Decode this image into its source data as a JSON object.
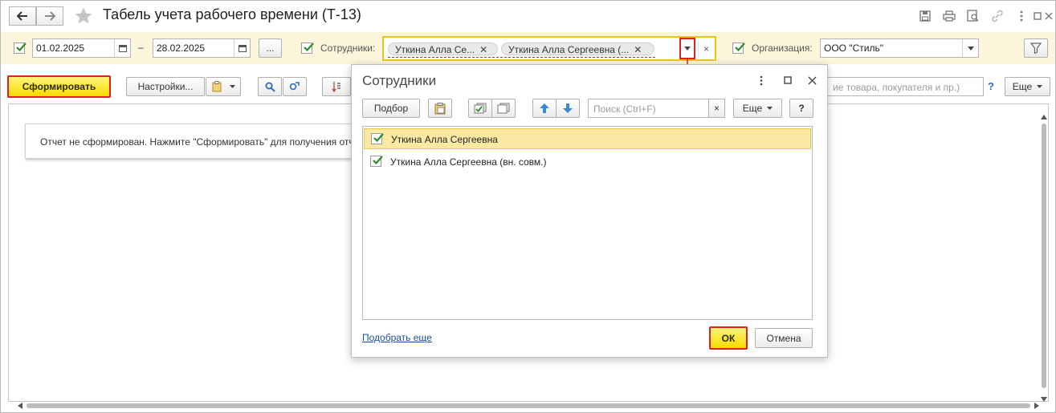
{
  "window": {
    "title": "Табель учета рабочего времени (Т-13)",
    "back_icon": "arrow-left-icon",
    "forward_icon": "arrow-right-icon",
    "favorite_icon": "star-icon",
    "top_icons": [
      "save-icon",
      "print-icon",
      "preview-icon",
      "link-icon",
      "more-vertical-icon",
      "maximize-icon",
      "close-icon"
    ]
  },
  "filters": {
    "period_enabled": true,
    "date_from": "01.02.2025",
    "dash": "–",
    "date_to": "28.02.2025",
    "period_more": "...",
    "employees_enabled": true,
    "employees_label": "Сотрудники:",
    "employee_tags": [
      "Уткина Алла Се...",
      "Уткина Алла Сергеевна (..."
    ],
    "clear_symbol": "×",
    "organization_enabled": true,
    "organization_label": "Организация:",
    "organization_value": "ООО \"Стиль\""
  },
  "toolbar": {
    "generate_label": "Сформировать",
    "settings_label": "Настройки...",
    "search_placeholder": "ие товара, покупателя и пр.)",
    "help_label": "?",
    "more_label": "Еще"
  },
  "report": {
    "notice": "Отчет не сформирован. Нажмите \"Сформировать\" для получения отчета."
  },
  "dialog": {
    "title": "Сотрудники",
    "pick_label": "Подбор",
    "search_placeholder": "Поиск (Ctrl+F)",
    "clear_symbol": "×",
    "more_label": "Еще",
    "help_label": "?",
    "items": [
      {
        "label": "Уткина Алла Сергеевна",
        "checked": true,
        "selected": true
      },
      {
        "label": "Уткина Алла Сергеевна (вн. совм.)",
        "checked": true,
        "selected": false
      }
    ],
    "pick_more_link": "Подобрать еще",
    "ok_label": "ОК",
    "cancel_label": "Отмена"
  },
  "colors": {
    "filter_bar_bg": "#fbf5dc",
    "primary_button": "#f7dc00",
    "highlight_frame": "#e02020",
    "selected_row": "#fbe9a3",
    "checkmark": "#2e8b2e",
    "link": "#1a4f9c"
  }
}
